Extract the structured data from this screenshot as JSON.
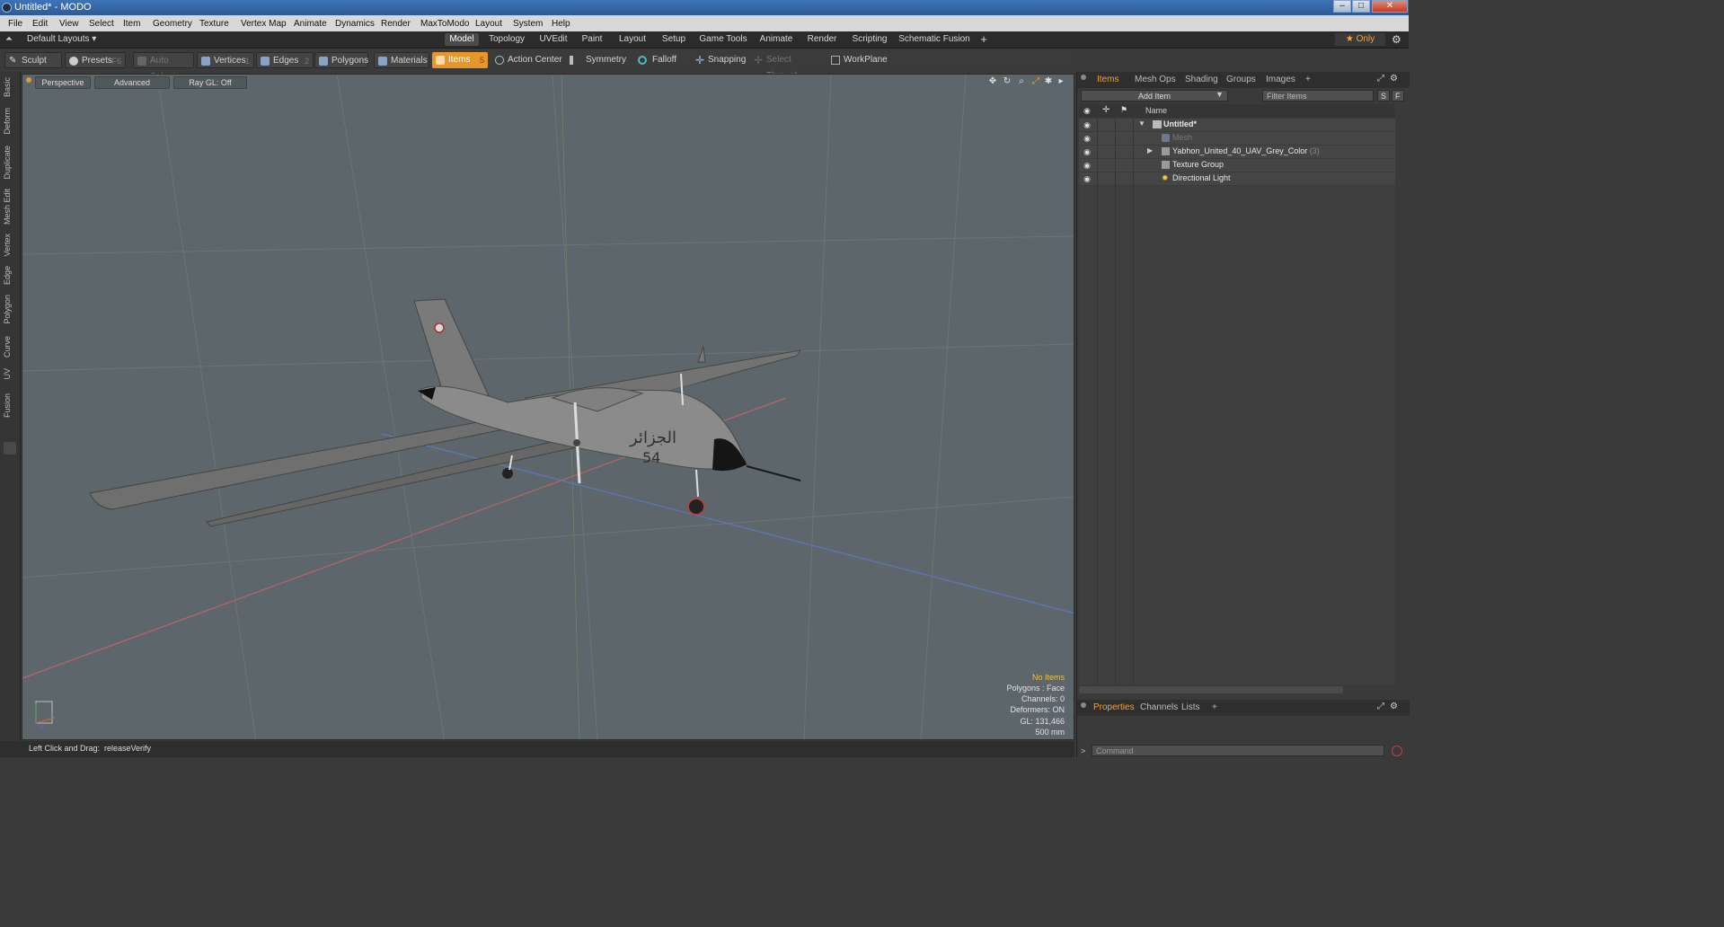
{
  "window": {
    "title": "Untitled* - MODO",
    "min": "–",
    "max": "□",
    "close": "✕"
  },
  "menu": [
    "File",
    "Edit",
    "View",
    "Select",
    "Item",
    "Geometry",
    "Texture",
    "Vertex Map",
    "Animate",
    "Dynamics",
    "Render",
    "MaxToModo",
    "Layout",
    "System",
    "Help"
  ],
  "layouts": {
    "selector": "Default Layouts ▾",
    "tabs": [
      "Model",
      "Topology",
      "UVEdit",
      "Paint",
      "Layout",
      "Setup",
      "Game Tools",
      "Animate",
      "Render",
      "Scripting",
      "Schematic Fusion",
      "+"
    ],
    "active": "Model",
    "only": "★ Only"
  },
  "toolbar": {
    "sculpt": "Sculpt",
    "presets": "Presets",
    "presets_key": "F6",
    "auto_select": "Auto Select",
    "vertices": "Vertices",
    "vertices_num": "1",
    "edges": "Edges",
    "edges_num": "2",
    "polygons": "Polygons",
    "materials": "Materials",
    "items": "Items",
    "items_num": "5",
    "action_center": "Action Center",
    "symmetry": "Symmetry",
    "falloff": "Falloff",
    "snapping": "Snapping",
    "select_through": "Select Through",
    "workplane": "WorkPlane"
  },
  "left_tabs": [
    "Basic",
    "Deform",
    "Duplicate",
    "Mesh Edit",
    "Vertex",
    "Edge",
    "Polygon",
    "Curve",
    "UV",
    "Fusion"
  ],
  "viewport": {
    "view": "Perspective",
    "shading": "Advanced",
    "raygl": "Ray GL: Off",
    "model_text": "الجزائر",
    "model_number": "54",
    "info": {
      "selection": "No Items",
      "polygons": "Polygons : Face",
      "channels": "Channels: 0",
      "deformers": "Deformers: ON",
      "gl": "GL: 131,466",
      "scale": "500 mm"
    }
  },
  "status": {
    "hint": "Left Click and Drag:",
    "action": "releaseVerify"
  },
  "right_panel": {
    "tabs": [
      "Items",
      "Mesh Ops",
      "Shading",
      "Groups",
      "Images",
      "+"
    ],
    "active_tab": "Items",
    "add_item": "Add Item",
    "filter_placeholder": "Filter Items",
    "btn_s": "S",
    "btn_f": "F",
    "column_name": "Name",
    "items": [
      {
        "name": "Untitled*",
        "count": ""
      },
      {
        "name": "Mesh",
        "count": ""
      },
      {
        "name": "Yabhon_United_40_UAV_Grey_Color",
        "count": "(3)"
      },
      {
        "name": "Texture Group",
        "count": ""
      },
      {
        "name": "Directional Light",
        "count": ""
      }
    ],
    "bottom_tabs": [
      "Properties",
      "Channels",
      "Lists",
      "+"
    ],
    "bottom_active": "Properties",
    "command_placeholder": "Command"
  }
}
